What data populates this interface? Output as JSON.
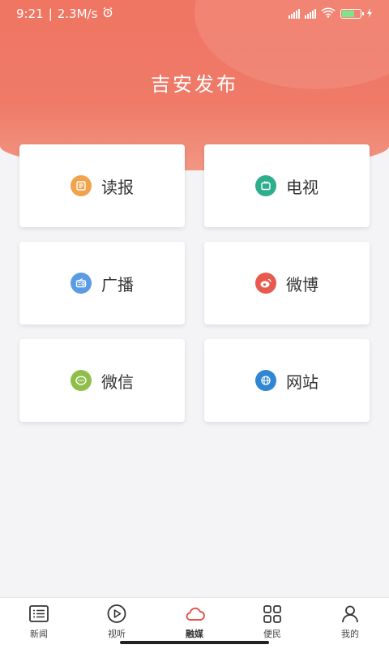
{
  "status_bar": {
    "time": "9:21",
    "separator": "|",
    "speed": "2.3M/s",
    "battery_color": "#7fe38a"
  },
  "header": {
    "title": "吉安发布",
    "bg_color": "#f07563"
  },
  "cards": [
    {
      "label": "读报",
      "icon": "newspaper-icon",
      "color": "#f0a34a"
    },
    {
      "label": "电视",
      "icon": "tv-icon",
      "color": "#2fae8e"
    },
    {
      "label": "广播",
      "icon": "radio-icon",
      "color": "#5b9be6"
    },
    {
      "label": "微博",
      "icon": "weibo-icon",
      "color": "#e85a4f"
    },
    {
      "label": "微信",
      "icon": "wechat-icon",
      "color": "#8fbf4a"
    },
    {
      "label": "网站",
      "icon": "globe-icon",
      "color": "#2f86d3"
    }
  ],
  "bottom_nav": [
    {
      "label": "新闻",
      "icon": "list-icon",
      "active": false
    },
    {
      "label": "视听",
      "icon": "play-icon",
      "active": false
    },
    {
      "label": "融媒",
      "icon": "cloud-icon",
      "active": true,
      "color": "#e0544a"
    },
    {
      "label": "便民",
      "icon": "grid-icon",
      "active": false
    },
    {
      "label": "我的",
      "icon": "user-icon",
      "active": false
    }
  ]
}
